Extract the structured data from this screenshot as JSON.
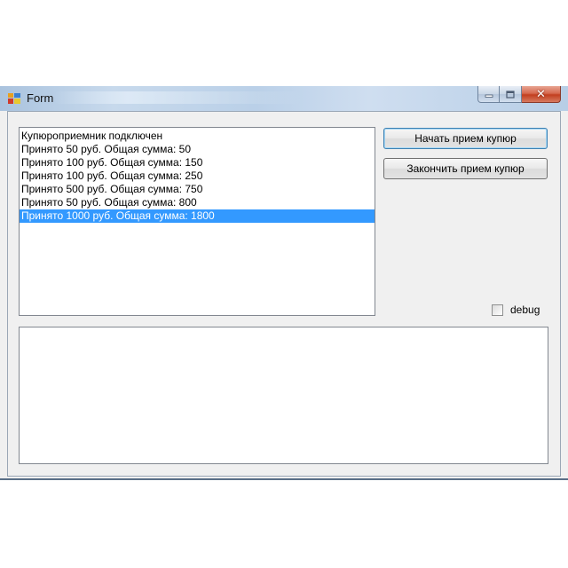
{
  "window": {
    "title": "Form",
    "close_glyph": "✕"
  },
  "listbox": {
    "items": [
      "Купюроприемник подключен",
      "Принято 50 руб. Общая сумма: 50",
      "Принято 100 руб. Общая сумма: 150",
      "Принято 100 руб. Общая сумма: 250",
      "Принято 500 руб. Общая сумма: 750",
      "Принято 50 руб. Общая сумма: 800",
      "Принято 1000 руб. Общая сумма: 1800"
    ],
    "selected_index": 6
  },
  "buttons": {
    "start_label": "Начать прием купюр",
    "stop_label": "Закончить прием купюр"
  },
  "debug": {
    "label": "debug",
    "checked": false
  },
  "output": {
    "value": ""
  },
  "colors": {
    "selection": "#3399ff",
    "close_button": "#c23f1f",
    "titlebar": "#bad0e8"
  },
  "icons": {
    "app": "app-icon",
    "minimize": "minimize-icon",
    "maximize": "maximize-icon",
    "close": "close-icon"
  }
}
